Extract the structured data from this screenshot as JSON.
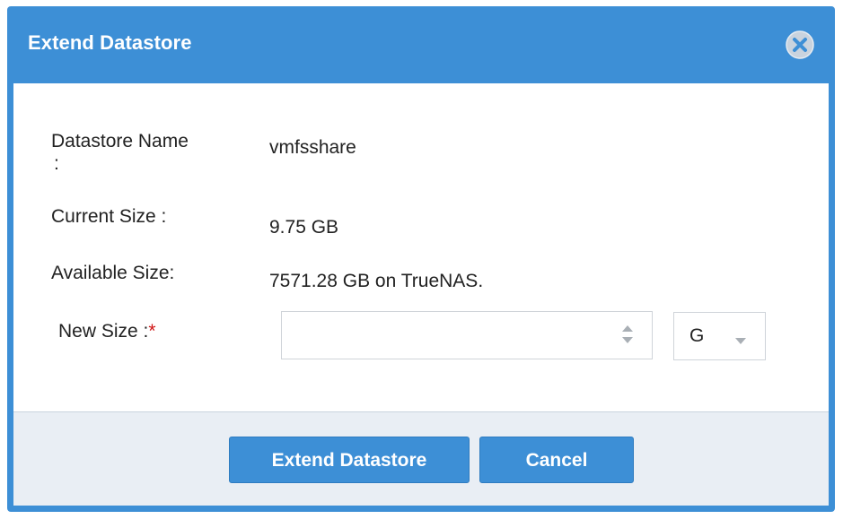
{
  "dialog": {
    "title": "Extend Datastore",
    "close_icon": "close-circle-icon"
  },
  "form": {
    "datastore_name_label": "Datastore Name",
    "datastore_name_colon": ":",
    "datastore_name_value": "vmfsshare",
    "current_size_label": "Current Size :",
    "current_size_value": "9.75 GB",
    "available_size_label": "Available Size:",
    "available_size_value": "7571.28 GB on TrueNAS.",
    "new_size_label": "New Size :",
    "required_marker": "*",
    "new_size_value": "",
    "new_size_placeholder": "",
    "unit_selected": "G"
  },
  "footer": {
    "extend_button_label": "Extend Datastore",
    "cancel_button_label": "Cancel"
  },
  "colors": {
    "accent": "#3d8fd6",
    "required": "#d01414",
    "footer_bg": "#e9eef4"
  }
}
